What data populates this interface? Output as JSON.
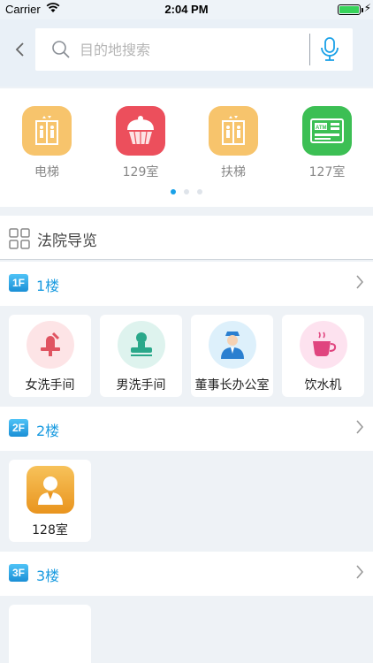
{
  "status_bar": {
    "carrier": "Carrier",
    "time": "2:04 PM"
  },
  "search": {
    "placeholder": "目的地搜索"
  },
  "quick_access": [
    {
      "label": "电梯",
      "icon": "elevator-icon",
      "color": "#f7c46c"
    },
    {
      "label": "129室",
      "icon": "cupcake-icon",
      "color": "#ec4f5c"
    },
    {
      "label": "扶梯",
      "icon": "escalator-icon",
      "color": "#f7c46c"
    },
    {
      "label": "127室",
      "icon": "atm-icon",
      "color": "#3cbf54"
    }
  ],
  "guide": {
    "title": "法院导览"
  },
  "floors": [
    {
      "badge": "1F",
      "name": "1楼",
      "rooms": [
        {
          "label": "女洗手间",
          "icon": "women-restroom-icon"
        },
        {
          "label": "男洗手间",
          "icon": "men-restroom-icon"
        },
        {
          "label": "董事长办公室",
          "icon": "chairman-office-icon"
        },
        {
          "label": "饮水机",
          "icon": "water-dispenser-icon"
        }
      ]
    },
    {
      "badge": "2F",
      "name": "2楼",
      "rooms": [
        {
          "label": "128室",
          "icon": "person-icon"
        }
      ]
    },
    {
      "badge": "3F",
      "name": "3楼",
      "rooms": []
    }
  ],
  "colors": {
    "accent": "#1a9be0",
    "background": "#eef2f6"
  }
}
